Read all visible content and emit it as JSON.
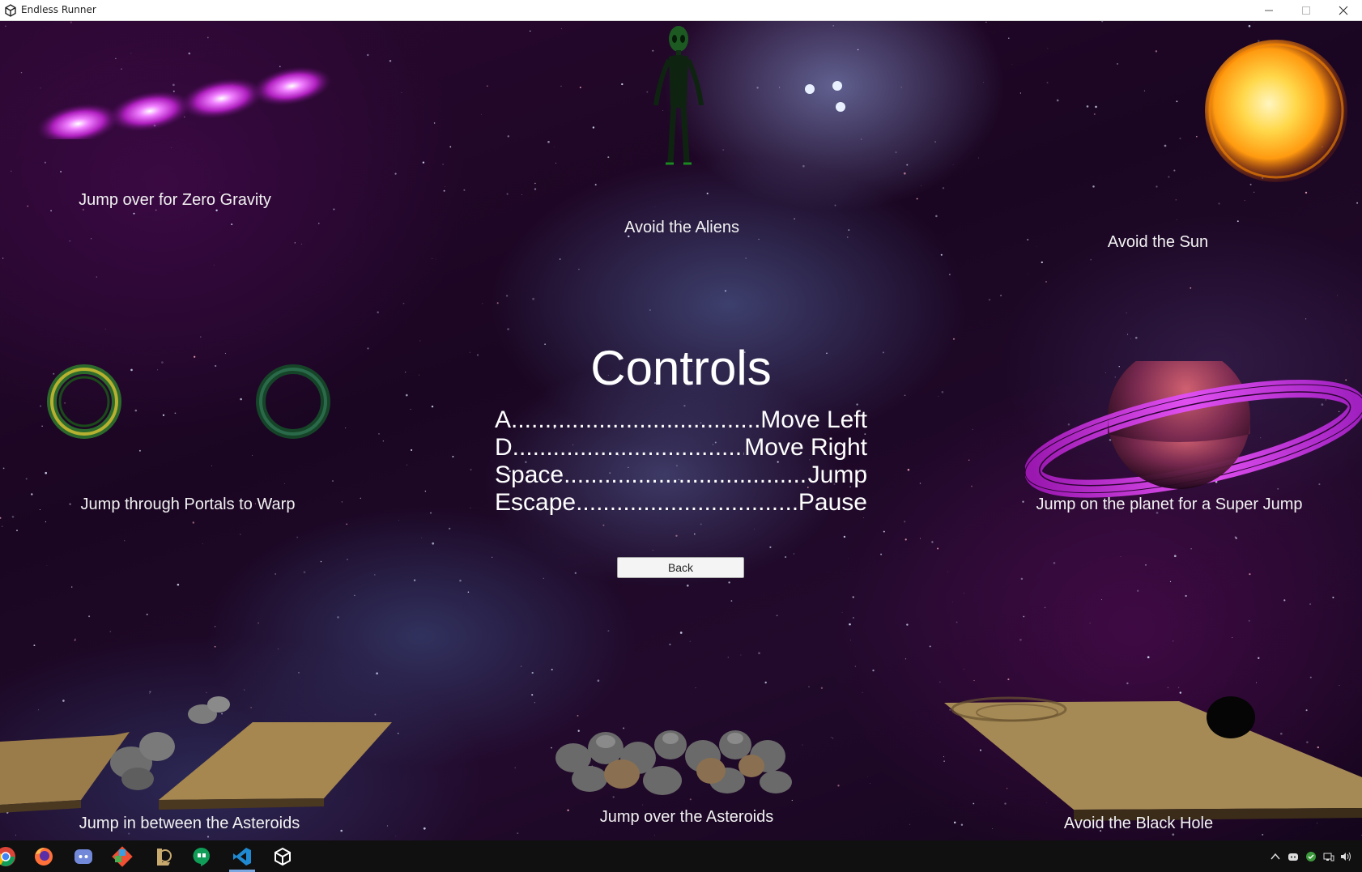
{
  "window": {
    "title": "Endless Runner"
  },
  "hints": {
    "zero_gravity": "Jump over for Zero Gravity",
    "aliens": "Avoid the Aliens",
    "sun": "Avoid the Sun",
    "portals": "Jump through Portals to Warp",
    "planet": "Jump on the planet for a Super Jump",
    "asteroids_between": "Jump in between the Asteroids",
    "asteroids_over": "Jump over the Asteroids",
    "black_hole": "Avoid the Black Hole"
  },
  "controls": {
    "title": "Controls",
    "rows": [
      {
        "key": "A",
        "action": "Move Left"
      },
      {
        "key": "D",
        "action": "Move Right"
      },
      {
        "key": "Space",
        "action": "Jump"
      },
      {
        "key": "Escape",
        "action": "Pause"
      }
    ]
  },
  "back_button": {
    "label": "Back"
  },
  "taskbar": {
    "apps": [
      "chrome-icon",
      "firefox-icon",
      "discord-icon",
      "git-icon",
      "league-icon",
      "hangouts-icon",
      "vscode-icon",
      "unity-icon"
    ],
    "tray": [
      "chevron-up-icon",
      "discord-tray-icon",
      "shield-tray-icon",
      "network-icon",
      "volume-icon"
    ]
  },
  "colors": {
    "text": "#ffffff",
    "space_bg": "#1a0622",
    "galaxy": "#b020c0",
    "sun": "#ffb020",
    "planet_ring": "#c030e0",
    "taskbar": "#101010"
  }
}
